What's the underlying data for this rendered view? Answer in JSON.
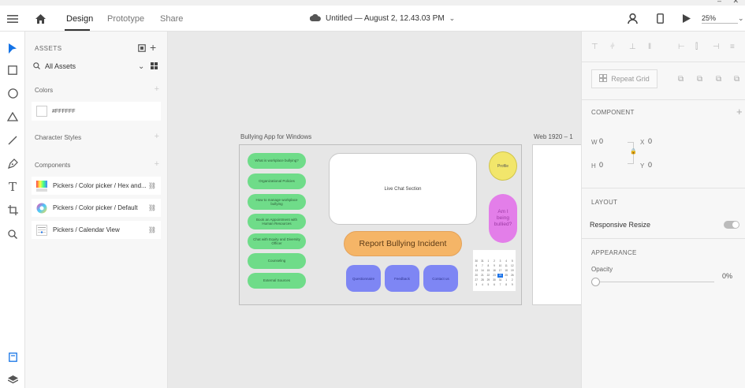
{
  "window": {
    "minimize": "–",
    "close": "✕"
  },
  "header": {
    "tabs": [
      {
        "label": "Design",
        "active": true
      },
      {
        "label": "Prototype",
        "active": false
      },
      {
        "label": "Share",
        "active": false
      }
    ],
    "doc_title": "Untitled — August 2, 12.43.03 PM",
    "zoom": "25%",
    "icons": [
      "menu-icon",
      "home-icon",
      "cloud-icon",
      "chevron-down-icon",
      "user-icon",
      "mobile-preview-icon",
      "play-icon"
    ]
  },
  "toolbar": {
    "tools": [
      "select-icon",
      "rectangle-icon",
      "ellipse-icon",
      "triangle-icon",
      "line-icon",
      "pen-icon",
      "text-icon",
      "artboard-icon",
      "zoom-icon"
    ],
    "bottom": [
      "document-assets-icon",
      "layers-icon"
    ]
  },
  "assets": {
    "title": "ASSETS",
    "filter": "All Assets",
    "colors_label": "Colors",
    "colors": [
      {
        "hex": "#FFFFFF",
        "label": "#FFFFFF"
      }
    ],
    "char_styles_label": "Character Styles",
    "components_label": "Components",
    "components": [
      {
        "label": "Pickers / Color picker / Hex and..."
      },
      {
        "label": "Pickers / Color picker / Default"
      },
      {
        "label": "Pickers / Calendar View"
      }
    ]
  },
  "canvas": {
    "artboard1_label": "Bullying App for Windows",
    "artboard2_label": "Web 1920 – 1",
    "menu_pills": [
      "What is workplace bullying?",
      "Organizational Policies",
      "How to manage workplace bullying",
      "Book an Appointment with Human Resources",
      "Chat with Equity and Diversity Officer",
      "Counseling",
      "External Sources"
    ],
    "chat": "Live Chat Section",
    "profile": "Profile",
    "bullied": "Am I being bullied?",
    "report": "Report Bullying Incident",
    "blue_buttons": [
      "Questionnaire",
      "Feedback",
      "Contact us"
    ],
    "calendar_days": [
      "30",
      "31",
      "1",
      "2",
      "3",
      "4",
      "5",
      "6",
      "7",
      "8",
      "9",
      "10",
      "11",
      "12",
      "13",
      "14",
      "15",
      "16",
      "17",
      "18",
      "19",
      "20",
      "21",
      "22",
      "23",
      "24",
      "25",
      "26",
      "27",
      "28",
      "29",
      "30",
      "31",
      "1",
      "2",
      "3",
      "4",
      "5",
      "6",
      "7",
      "8",
      "9"
    ],
    "calendar_selected": "24",
    "colors": {
      "pill": "#6fdc89",
      "report": "#f5b567",
      "blue": "#7e86f4",
      "profile": "#f2e66b",
      "bullied": "#e37ee9"
    }
  },
  "properties": {
    "repeat_grid": "Repeat Grid",
    "component_header": "COMPONENT",
    "w_label": "W",
    "w_value": "0",
    "x_label": "X",
    "x_value": "0",
    "h_label": "H",
    "h_value": "0",
    "y_label": "Y",
    "y_value": "0",
    "layout_header": "LAYOUT",
    "responsive_resize": "Responsive Resize",
    "appearance_header": "APPEARANCE",
    "opacity_label": "Opacity",
    "opacity_value": "0%"
  }
}
